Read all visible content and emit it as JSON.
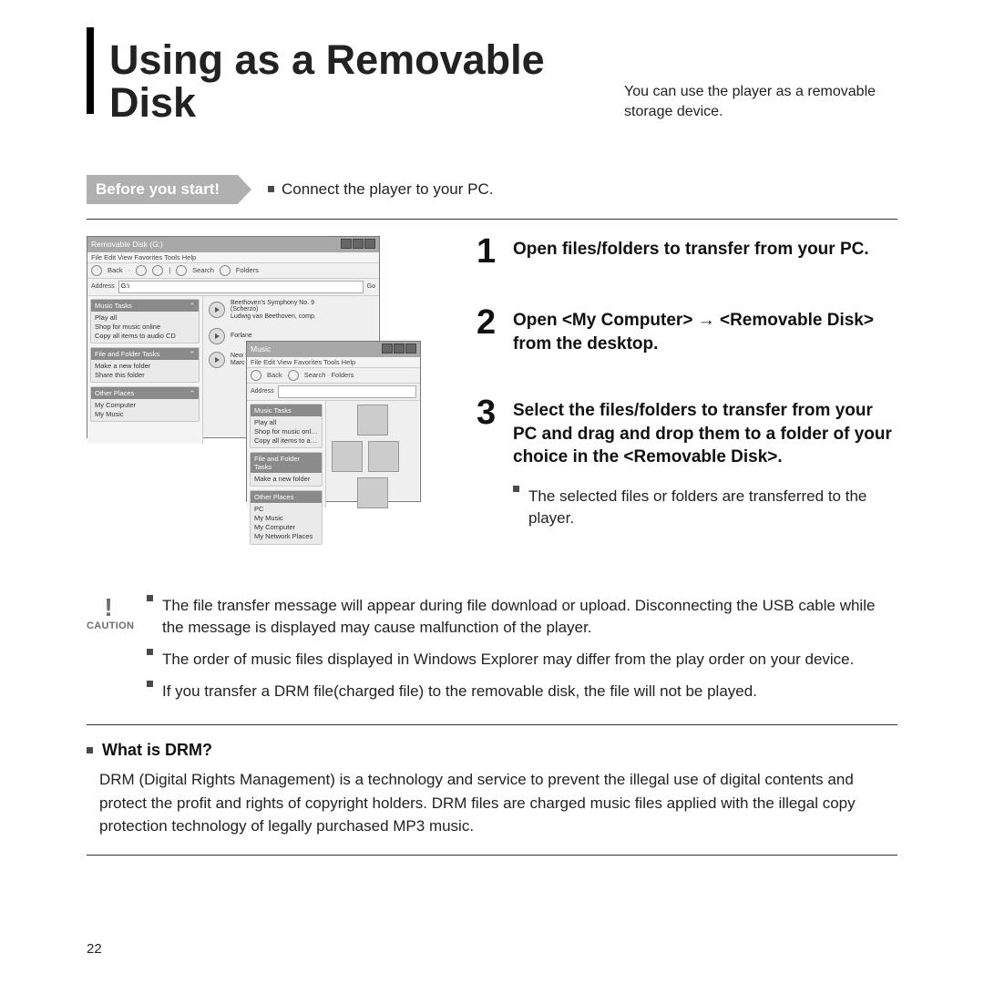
{
  "page_number": "22",
  "header": {
    "title": "Using as a Removable Disk",
    "subtitle": "You can use the player as a removable storage device."
  },
  "before": {
    "badge": "Before you start!",
    "text": "Connect the player to your PC."
  },
  "screenshot": {
    "back_window": {
      "title": "Removable Disk (G:)",
      "menu": "File   Edit   View   Favorites   Tools   Help",
      "toolbar_back": "Back",
      "toolbar_search": "Search",
      "toolbar_folders": "Folders",
      "address_label": "Address",
      "address_value": "G:\\",
      "go": "Go",
      "panels": {
        "music_tasks_h": "Music Tasks",
        "music_tasks_items": [
          "Play all",
          "Shop for music online",
          "Copy all items to audio CD"
        ],
        "file_folder_h": "File and Folder Tasks",
        "file_folder_items": [
          "Make a new folder",
          "Share this folder"
        ],
        "other_places_h": "Other Places",
        "other_places_items": [
          "My Computer",
          "My Music"
        ]
      },
      "tracks": [
        {
          "t": "Beethoven's Symphony No. 9",
          "s": "(Scherzo)",
          "a": "Ludwig van Beethoven, comp."
        },
        {
          "t": "Forlane",
          "s": "",
          "a": ""
        },
        {
          "t": "New Stories (Highway Blues)",
          "s": "",
          "a": "Marc Seales, composer"
        }
      ]
    },
    "front_window": {
      "title": "Music",
      "menu": "File   Edit   View   Favorites   Tools   Help",
      "toolbar_back": "Back",
      "toolbar_search": "Search",
      "toolbar_folders": "Folders",
      "address_label": "Address",
      "panels": {
        "music_tasks_h": "Music Tasks",
        "music_tasks_items": [
          "Play all",
          "Shop for music online",
          "Copy all items to audio"
        ],
        "file_folder_h": "File and Folder Tasks",
        "file_folder_items": [
          "Make a new folder"
        ],
        "other_places_h": "Other Places",
        "other_places_items": [
          "PC",
          "My Music",
          "My Computer",
          "My Network Places"
        ]
      }
    }
  },
  "steps": [
    {
      "num": "1",
      "title": "Open files/folders to transfer from your PC."
    },
    {
      "num": "2",
      "title": "Open <My Computer> → <Removable Disk> from the desktop."
    },
    {
      "num": "3",
      "title": "Select the files/folders to transfer from your PC and drag and drop them to a folder of your choice in the <Removable Disk>.",
      "sub": "The selected files or folders are transferred to the player."
    }
  ],
  "caution": {
    "mark": "!",
    "label": "CAUTION",
    "items": [
      "The file transfer message will appear during file download or upload. Disconnecting the USB cable while the message is displayed may cause malfunction of the player.",
      "The order of music files displayed in Windows Explorer may differ from the play order on your device.",
      "If you transfer a DRM file(charged file)  to the removable disk, the file will not be played."
    ]
  },
  "drm": {
    "title": "What is DRM?",
    "body": "DRM (Digital Rights Management) is a technology and service to prevent the illegal use of digital contents and protect the profit and rights of copyright holders. DRM files are charged music files applied with the illegal copy protection technology of legally purchased MP3 music."
  }
}
